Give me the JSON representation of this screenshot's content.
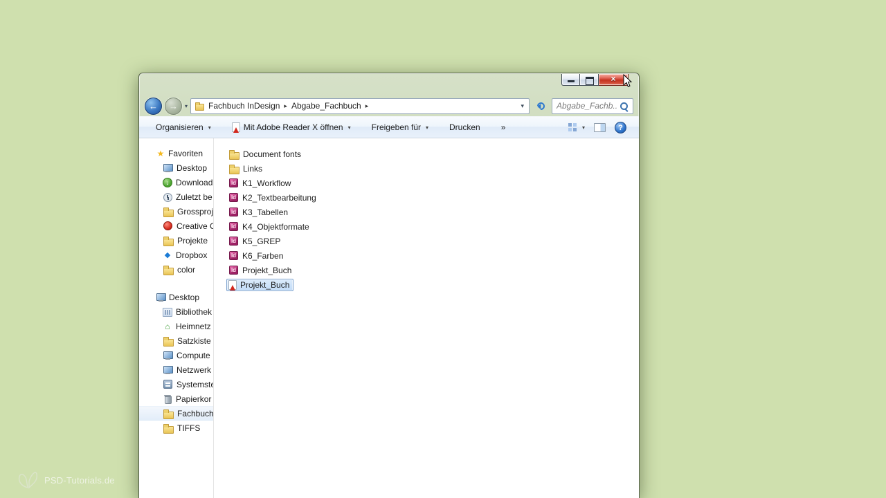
{
  "page": {
    "watermark": "PSD-Tutorials.de"
  },
  "icons": {
    "back": "←",
    "forward": "→",
    "dropdown": "▾",
    "crumb_sep": "▸",
    "more": "»",
    "help": "?",
    "star": "★",
    "download": "↓",
    "home": "⌂",
    "dropbox": "◆",
    "close": "×",
    "id_badge": "Id"
  },
  "colors": {
    "page_background": "#cfe0ae",
    "selection_border": "#7da2ce",
    "selection_fill": "#cfe3f8",
    "folder_yellow": "#e9c455",
    "indesign_pink": "#b8327a",
    "pdf_red": "#d2281e",
    "close_button_red": "#c5321f"
  },
  "window": {
    "address": {
      "crumbs": [
        {
          "label": "Fachbuch InDesign"
        },
        {
          "label": "Abgabe_Fachbuch"
        }
      ],
      "search_value": "Abgabe_Fachb..."
    },
    "toolbar": {
      "organize": "Organisieren",
      "open_with": "Mit Adobe Reader X öffnen",
      "share": "Freigeben für",
      "print": "Drucken"
    },
    "sidebar": {
      "sections": [
        {
          "label": "Favoriten",
          "items": [
            {
              "label": "Desktop"
            },
            {
              "label": "Download"
            },
            {
              "label": "Zuletzt be"
            },
            {
              "label": "Grossproj"
            },
            {
              "label": "Creative C"
            },
            {
              "label": "Projekte"
            },
            {
              "label": "Dropbox"
            },
            {
              "label": "color"
            }
          ]
        },
        {
          "label": "Desktop",
          "items": [
            {
              "label": "Bibliothek"
            },
            {
              "label": "Heimnetz"
            },
            {
              "label": "Satzkiste"
            },
            {
              "label": "Compute"
            },
            {
              "label": "Netzwerk"
            },
            {
              "label": "Systemste"
            },
            {
              "label": "Papierkor"
            },
            {
              "label": "Fachbuch",
              "selected": true
            },
            {
              "label": "TIFFS"
            }
          ]
        }
      ]
    },
    "files": [
      {
        "name": "Document fonts",
        "type": "folder"
      },
      {
        "name": "Links",
        "type": "folder"
      },
      {
        "name": "K1_Workflow",
        "type": "indesign"
      },
      {
        "name": "K2_Textbearbeitung",
        "type": "indesign"
      },
      {
        "name": "K3_Tabellen",
        "type": "indesign"
      },
      {
        "name": "K4_Objektformate",
        "type": "indesign"
      },
      {
        "name": "K5_GREP",
        "type": "indesign"
      },
      {
        "name": "K6_Farben",
        "type": "indesign"
      },
      {
        "name": "Projekt_Buch",
        "type": "indesign"
      },
      {
        "name": "Projekt_Buch",
        "type": "pdf",
        "selected": true
      }
    ]
  }
}
